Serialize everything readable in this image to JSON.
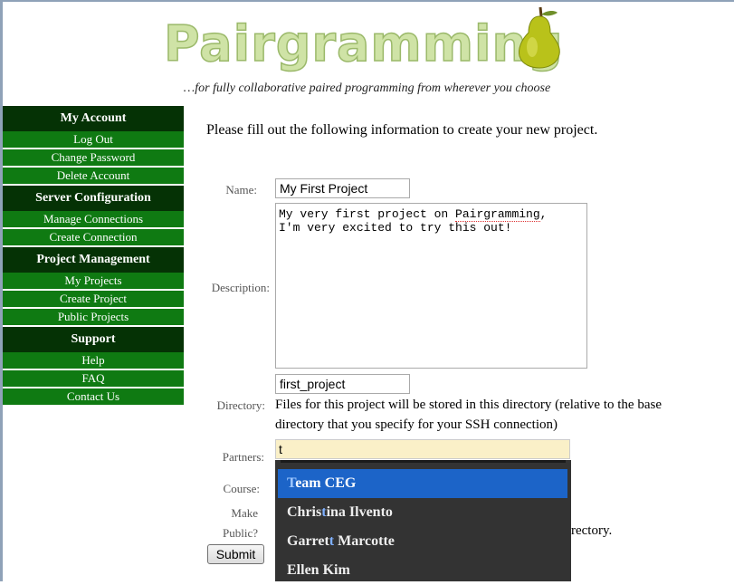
{
  "header": {
    "logo_text": "Pairgramming",
    "tagline": "…for fully collaborative paired programming from wherever you choose"
  },
  "sidebar": {
    "sections": [
      {
        "title": "My Account",
        "items": [
          "Log Out",
          "Change Password",
          "Delete Account"
        ]
      },
      {
        "title": "Server Configuration",
        "items": [
          "Manage Connections",
          "Create Connection"
        ]
      },
      {
        "title": "Project Management",
        "items": [
          "My Projects",
          "Create Project",
          "Public Projects"
        ]
      },
      {
        "title": "Support",
        "items": [
          "Help",
          "FAQ",
          "Contact Us"
        ]
      }
    ]
  },
  "form": {
    "intro": "Please fill out the following information to create your new project.",
    "name_label": "Name:",
    "name_value": "My First Project",
    "description_label": "Description:",
    "description_line1_pre": "My very first project on ",
    "description_line1_spell": "Pairgramming",
    "description_line1_post": ",",
    "description_line2": "I'm very excited to try this out!",
    "directory_label": "Directory:",
    "directory_value": "first_project",
    "directory_help": "Files for this project will be stored in this directory (relative to the base directory that you specify for your SSH connection)",
    "partners_label": "Partners:",
    "partners_value": "t",
    "course_label": "Course:",
    "make_public_label_1": "Make",
    "make_public_label_2": "Public?",
    "obscured_text": "rectory.",
    "submit_label": "Submit"
  },
  "autocomplete": {
    "items": [
      {
        "pre": "",
        "match": "T",
        "post": "eam CEG",
        "selected": true
      },
      {
        "pre": "Chris",
        "match": "t",
        "post": "ina Ilvento",
        "selected": false
      },
      {
        "pre": "Garret",
        "match": "t",
        "post": " Marcotte",
        "selected": false
      },
      {
        "pre": "Ellen Kim",
        "match": "",
        "post": "",
        "selected": false
      }
    ]
  }
}
